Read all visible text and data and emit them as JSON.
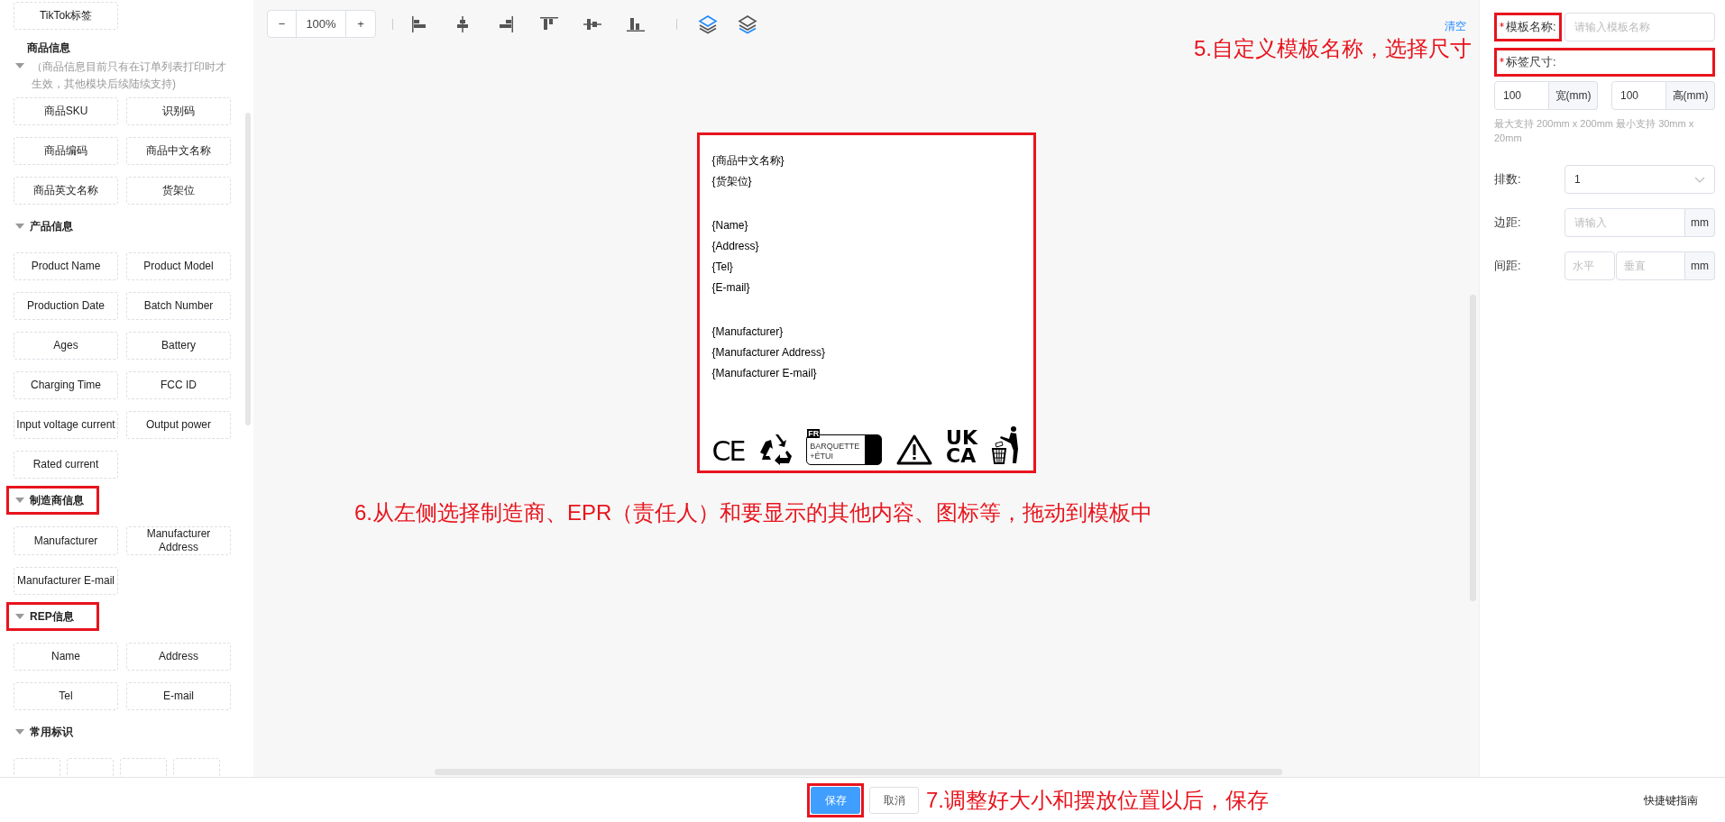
{
  "sidebar": {
    "top_item": "TikTok标签",
    "sections": [
      {
        "kind": "fields",
        "title": "商品信息",
        "note": "（商品信息目前只有在订单列表打印时才生效，其他模块后续陆续支持)",
        "expanded": true,
        "highlighted": false,
        "items": [
          "商品SKU",
          "识别码",
          "商品编码",
          "商品中文名称",
          "商品英文名称",
          "货架位"
        ]
      },
      {
        "kind": "fields",
        "title": "产品信息",
        "expanded": true,
        "highlighted": false,
        "items": [
          "Product Name",
          "Product Model",
          "Production Date",
          "Batch Number",
          "Ages",
          "Battery",
          "Charging Time",
          "FCC ID",
          "Input voltage current",
          "Output power",
          "Rated current"
        ]
      },
      {
        "kind": "fields",
        "title": "制造商信息",
        "expanded": true,
        "highlighted": true,
        "items": [
          "Manufacturer",
          "Manufacturer Address",
          "Manufacturer E-mail"
        ]
      },
      {
        "kind": "fields",
        "title": "REP信息",
        "expanded": true,
        "highlighted": true,
        "items": [
          "Name",
          "Address",
          "Tel",
          "E-mail"
        ]
      },
      {
        "kind": "icons",
        "title": "常用标识",
        "expanded": true,
        "highlighted": false
      }
    ]
  },
  "toolbar": {
    "zoom_out": "−",
    "zoom": "100%",
    "zoom_in": "+",
    "clear": "清空"
  },
  "canvas": {
    "label": {
      "highlighted": true,
      "groups": [
        [
          "{商品中文名称}",
          "{货架位}"
        ],
        [
          "{Name}",
          "{Address}",
          "{Tel}",
          "{E-mail}"
        ],
        [
          "{Manufacturer}",
          "{Manufacturer Address}",
          "{Manufacturer E-mail}"
        ]
      ],
      "symbols": [
        {
          "kind": "ce",
          "texts": [
            "CE"
          ]
        },
        {
          "kind": "recycle"
        },
        {
          "kind": "triman",
          "texts": [
            "FR",
            "BARQUETTE",
            "+ÉTUI"
          ]
        },
        {
          "kind": "warning"
        },
        {
          "kind": "ukca",
          "texts": [
            "UK",
            "CA"
          ]
        },
        {
          "kind": "tidyman"
        }
      ]
    },
    "annotation": "6.从左侧选择制造商、EPR（责任人）和要显示的其他内容、图标等，拖动到模板中"
  },
  "right_panel": {
    "annotation": "5.自定义模板名称，选择尺寸",
    "template_name": {
      "label": "模板名称:",
      "required": true,
      "highlighted": true,
      "placeholder": "请输入模板名称"
    },
    "label_size": {
      "label": "标签尺寸:",
      "required": true,
      "highlighted": true,
      "width": {
        "value": "100",
        "unit": "宽(mm)"
      },
      "height": {
        "value": "100",
        "unit": "高(mm)"
      },
      "hint": "最大支持 200mm x 200mm 最小支持 30mm x 20mm"
    },
    "rows": {
      "label": "排数:",
      "value": "1"
    },
    "margin": {
      "label": "边距:",
      "placeholder": "请输入",
      "unit": "mm"
    },
    "spacing": {
      "label": "间距:",
      "horizontal_placeholder": "水平",
      "vertical_placeholder": "垂直",
      "unit": "mm"
    }
  },
  "footer": {
    "buttons": [
      {
        "label": "保存",
        "kind": "primary",
        "highlighted": true
      },
      {
        "label": "取消",
        "kind": "default",
        "highlighted": false
      }
    ],
    "annotation": "7.调整好大小和摆放位置以后，保存",
    "shortcuts_link": "快捷键指南"
  }
}
